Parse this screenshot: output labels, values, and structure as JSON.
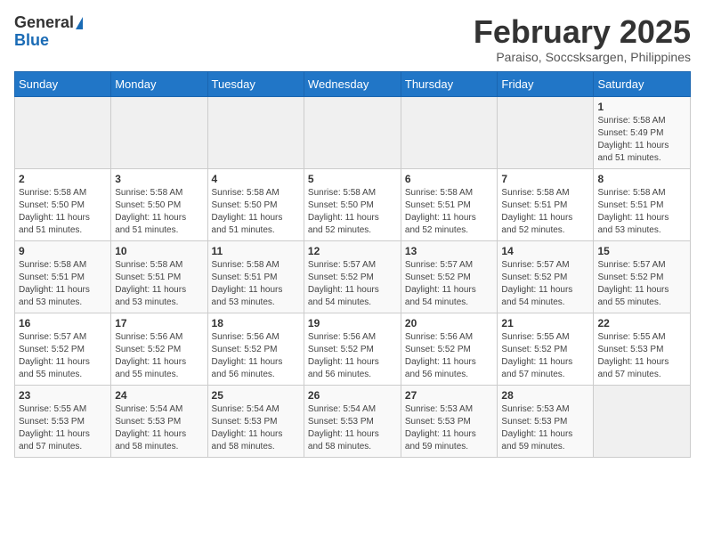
{
  "header": {
    "logo_general": "General",
    "logo_blue": "Blue",
    "title": "February 2025",
    "subtitle": "Paraiso, Soccsksargen, Philippines"
  },
  "weekdays": [
    "Sunday",
    "Monday",
    "Tuesday",
    "Wednesday",
    "Thursday",
    "Friday",
    "Saturday"
  ],
  "weeks": [
    [
      {
        "day": "",
        "info": ""
      },
      {
        "day": "",
        "info": ""
      },
      {
        "day": "",
        "info": ""
      },
      {
        "day": "",
        "info": ""
      },
      {
        "day": "",
        "info": ""
      },
      {
        "day": "",
        "info": ""
      },
      {
        "day": "1",
        "info": "Sunrise: 5:58 AM\nSunset: 5:49 PM\nDaylight: 11 hours\nand 51 minutes."
      }
    ],
    [
      {
        "day": "2",
        "info": "Sunrise: 5:58 AM\nSunset: 5:50 PM\nDaylight: 11 hours\nand 51 minutes."
      },
      {
        "day": "3",
        "info": "Sunrise: 5:58 AM\nSunset: 5:50 PM\nDaylight: 11 hours\nand 51 minutes."
      },
      {
        "day": "4",
        "info": "Sunrise: 5:58 AM\nSunset: 5:50 PM\nDaylight: 11 hours\nand 51 minutes."
      },
      {
        "day": "5",
        "info": "Sunrise: 5:58 AM\nSunset: 5:50 PM\nDaylight: 11 hours\nand 52 minutes."
      },
      {
        "day": "6",
        "info": "Sunrise: 5:58 AM\nSunset: 5:51 PM\nDaylight: 11 hours\nand 52 minutes."
      },
      {
        "day": "7",
        "info": "Sunrise: 5:58 AM\nSunset: 5:51 PM\nDaylight: 11 hours\nand 52 minutes."
      },
      {
        "day": "8",
        "info": "Sunrise: 5:58 AM\nSunset: 5:51 PM\nDaylight: 11 hours\nand 53 minutes."
      }
    ],
    [
      {
        "day": "9",
        "info": "Sunrise: 5:58 AM\nSunset: 5:51 PM\nDaylight: 11 hours\nand 53 minutes."
      },
      {
        "day": "10",
        "info": "Sunrise: 5:58 AM\nSunset: 5:51 PM\nDaylight: 11 hours\nand 53 minutes."
      },
      {
        "day": "11",
        "info": "Sunrise: 5:58 AM\nSunset: 5:51 PM\nDaylight: 11 hours\nand 53 minutes."
      },
      {
        "day": "12",
        "info": "Sunrise: 5:57 AM\nSunset: 5:52 PM\nDaylight: 11 hours\nand 54 minutes."
      },
      {
        "day": "13",
        "info": "Sunrise: 5:57 AM\nSunset: 5:52 PM\nDaylight: 11 hours\nand 54 minutes."
      },
      {
        "day": "14",
        "info": "Sunrise: 5:57 AM\nSunset: 5:52 PM\nDaylight: 11 hours\nand 54 minutes."
      },
      {
        "day": "15",
        "info": "Sunrise: 5:57 AM\nSunset: 5:52 PM\nDaylight: 11 hours\nand 55 minutes."
      }
    ],
    [
      {
        "day": "16",
        "info": "Sunrise: 5:57 AM\nSunset: 5:52 PM\nDaylight: 11 hours\nand 55 minutes."
      },
      {
        "day": "17",
        "info": "Sunrise: 5:56 AM\nSunset: 5:52 PM\nDaylight: 11 hours\nand 55 minutes."
      },
      {
        "day": "18",
        "info": "Sunrise: 5:56 AM\nSunset: 5:52 PM\nDaylight: 11 hours\nand 56 minutes."
      },
      {
        "day": "19",
        "info": "Sunrise: 5:56 AM\nSunset: 5:52 PM\nDaylight: 11 hours\nand 56 minutes."
      },
      {
        "day": "20",
        "info": "Sunrise: 5:56 AM\nSunset: 5:52 PM\nDaylight: 11 hours\nand 56 minutes."
      },
      {
        "day": "21",
        "info": "Sunrise: 5:55 AM\nSunset: 5:52 PM\nDaylight: 11 hours\nand 57 minutes."
      },
      {
        "day": "22",
        "info": "Sunrise: 5:55 AM\nSunset: 5:53 PM\nDaylight: 11 hours\nand 57 minutes."
      }
    ],
    [
      {
        "day": "23",
        "info": "Sunrise: 5:55 AM\nSunset: 5:53 PM\nDaylight: 11 hours\nand 57 minutes."
      },
      {
        "day": "24",
        "info": "Sunrise: 5:54 AM\nSunset: 5:53 PM\nDaylight: 11 hours\nand 58 minutes."
      },
      {
        "day": "25",
        "info": "Sunrise: 5:54 AM\nSunset: 5:53 PM\nDaylight: 11 hours\nand 58 minutes."
      },
      {
        "day": "26",
        "info": "Sunrise: 5:54 AM\nSunset: 5:53 PM\nDaylight: 11 hours\nand 58 minutes."
      },
      {
        "day": "27",
        "info": "Sunrise: 5:53 AM\nSunset: 5:53 PM\nDaylight: 11 hours\nand 59 minutes."
      },
      {
        "day": "28",
        "info": "Sunrise: 5:53 AM\nSunset: 5:53 PM\nDaylight: 11 hours\nand 59 minutes."
      },
      {
        "day": "",
        "info": ""
      }
    ]
  ]
}
